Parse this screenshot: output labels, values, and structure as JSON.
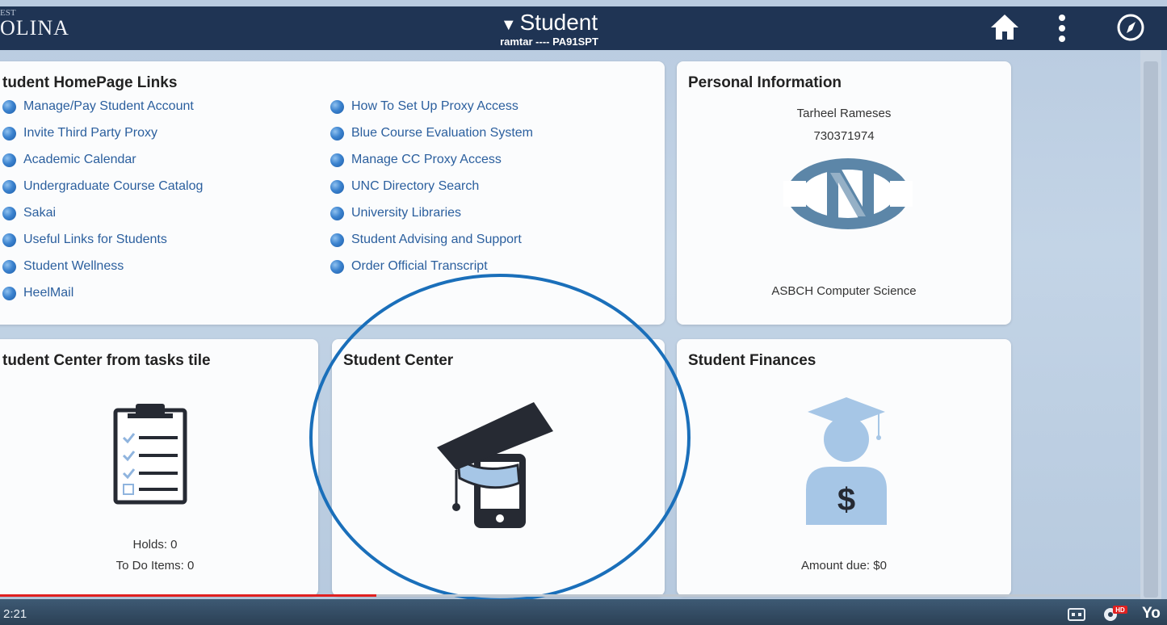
{
  "header": {
    "logo_prefix": "EST",
    "logo_text": "OLINA",
    "title": "Student",
    "subtitle": "ramtar ---- PA91SPT"
  },
  "links_tile": {
    "title": "tudent HomePage Links",
    "left_links": [
      "Manage/Pay Student Account",
      "Invite Third Party Proxy",
      "Academic Calendar",
      "Undergraduate Course Catalog",
      "Sakai",
      "Useful Links for Students",
      "Student Wellness",
      "HeelMail"
    ],
    "right_links": [
      "How To Set Up Proxy Access",
      "Blue Course Evaluation System",
      "Manage CC Proxy Access",
      "UNC Directory Search",
      "University Libraries",
      "Student Advising and Support",
      "Order Official Transcript"
    ]
  },
  "personal_tile": {
    "title": "Personal Information",
    "name": "Tarheel Rameses",
    "id_number": "730371974",
    "program": "ASBCH Computer Science"
  },
  "tasks_tile": {
    "title": "tudent Center from tasks tile",
    "holds": "Holds: 0",
    "todo": "To Do Items: 0"
  },
  "center_tile": {
    "title": "Student Center"
  },
  "finances_tile": {
    "title": "Student Finances",
    "amount_due": "Amount due: $0"
  },
  "player": {
    "timecode": "2:21",
    "progress_fraction": 0.33,
    "logo_text": "Yo",
    "hd_badge": "HD"
  },
  "colors": {
    "header_bg": "#1f3454",
    "link": "#2b5f9e",
    "circle": "#1a6fba",
    "icon_dark": "#262a33",
    "icon_light": "#a6c6e6",
    "progress": "#e02020"
  }
}
